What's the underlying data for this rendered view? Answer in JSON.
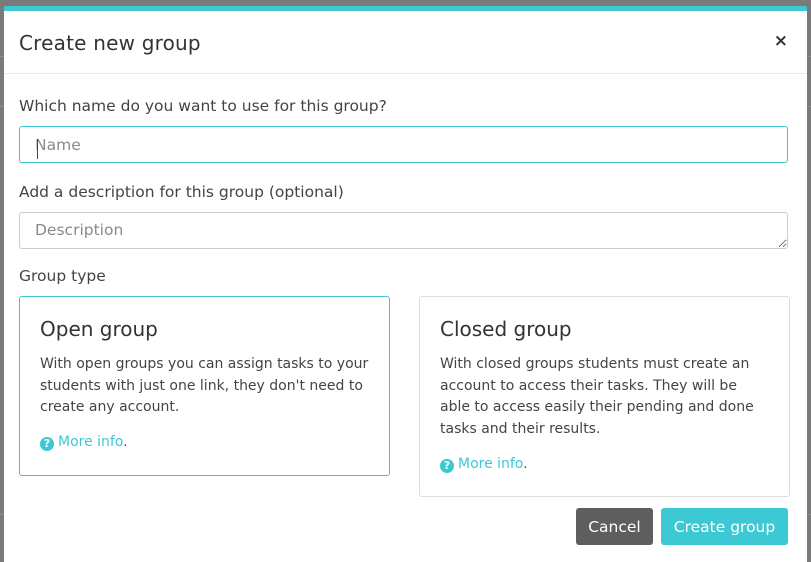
{
  "modal": {
    "title": "Create new group",
    "close_symbol": "×"
  },
  "form": {
    "name_label": "Which name do you want to use for this group?",
    "name_placeholder": "Name",
    "name_value": "",
    "description_label": "Add a description for this group (optional)",
    "description_placeholder": "Description",
    "description_value": "",
    "group_type_label": "Group type"
  },
  "group_types": [
    {
      "title": "Open group",
      "description": "With open groups you can assign tasks to your students with just one link, they don't need to create any account.",
      "more_info_label": "More info",
      "more_info_suffix": ".",
      "selected": true
    },
    {
      "title": "Closed group",
      "description": "With closed groups students must create an account to access their tasks. They will be able to access easily their pending and done tasks and their results.",
      "more_info_label": "More info",
      "more_info_suffix": ".",
      "selected": false
    }
  ],
  "icons": {
    "help": "question-circle-icon",
    "close": "close-icon"
  },
  "actions": {
    "cancel_label": "Cancel",
    "create_label": "Create group"
  },
  "colors": {
    "accent": "#3cc9d4",
    "cancel_bg": "#5e5e5e",
    "backdrop": "#7a7a7a"
  }
}
